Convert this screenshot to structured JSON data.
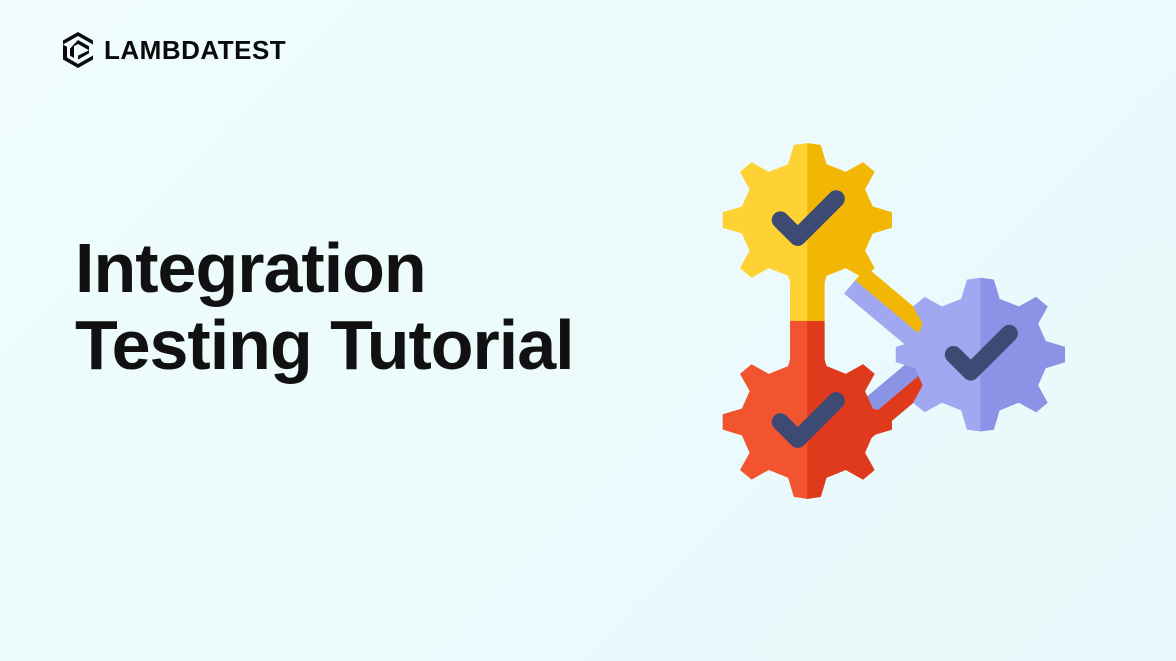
{
  "brand": {
    "name": "LAMBDATEST"
  },
  "heading": {
    "line1": "Integration",
    "line2": "Testing Tutorial"
  },
  "colors": {
    "gear_yellow_light": "#FFD233",
    "gear_yellow_dark": "#F2B705",
    "gear_red_light": "#F25430",
    "gear_red_dark": "#E03A1C",
    "gear_purple_light": "#9FA8F0",
    "gear_purple_dark": "#8A93E6",
    "check": "#3D4A73"
  }
}
